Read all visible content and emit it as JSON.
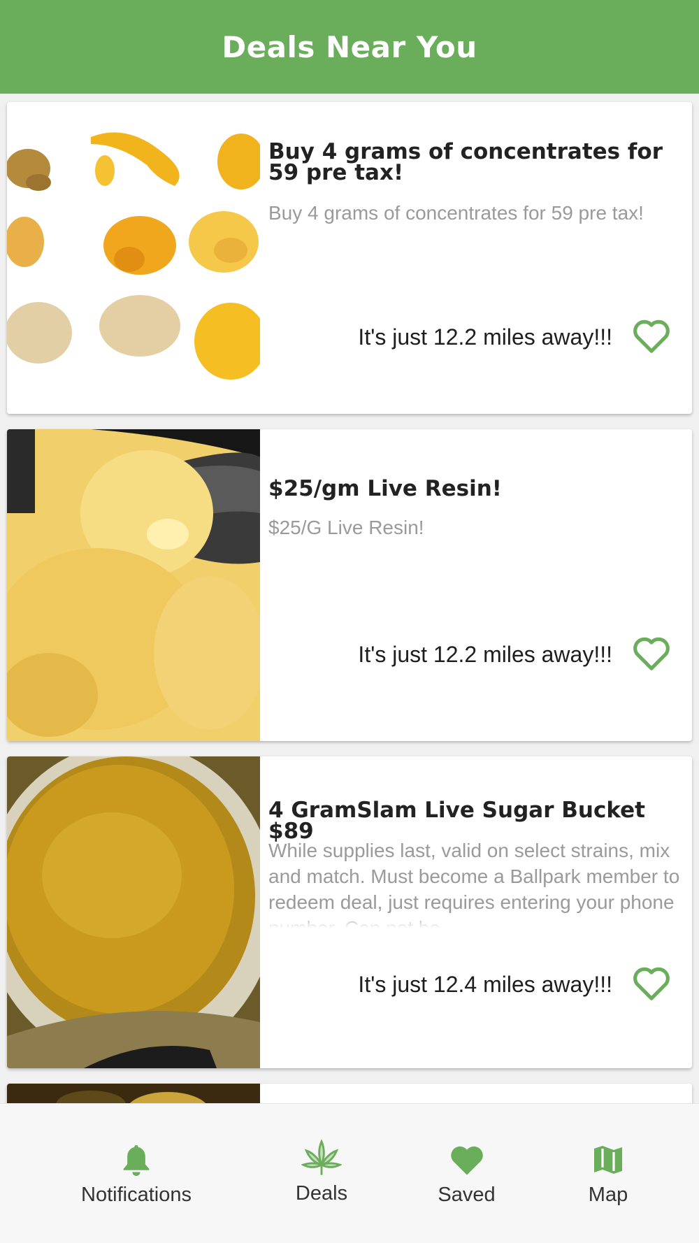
{
  "header": {
    "title": "Deals Near You"
  },
  "accent_color": "#6aae5b",
  "deals": [
    {
      "title": "Buy 4 grams of concentrates for 59 pre tax!",
      "description": "Buy 4 grams of concentrates for 59 pre tax!",
      "distance": "It's just 12.2 miles away!!!",
      "image": "concentrates-assortment"
    },
    {
      "title": "$25/gm Live Resin!",
      "description": "$25/G Live Resin!",
      "distance": "It's just 12.2 miles away!!!",
      "image": "live-resin-on-spoon"
    },
    {
      "title": "4 GramSlam Live Sugar Bucket $89",
      "description": "While supplies last, valid on select strains, mix and match. Must become a Ballpark member to redeem deal, just requires entering your phone number. Can not be",
      "distance": "It's just 12.4 miles away!!!",
      "image": "live-sugar-jar"
    }
  ],
  "tabs": [
    {
      "label": "Notifications",
      "icon": "bell-icon"
    },
    {
      "label": "Deals",
      "icon": "cannabis-leaf-icon"
    },
    {
      "label": "Saved",
      "icon": "heart-icon"
    },
    {
      "label": "Map",
      "icon": "map-icon"
    }
  ]
}
